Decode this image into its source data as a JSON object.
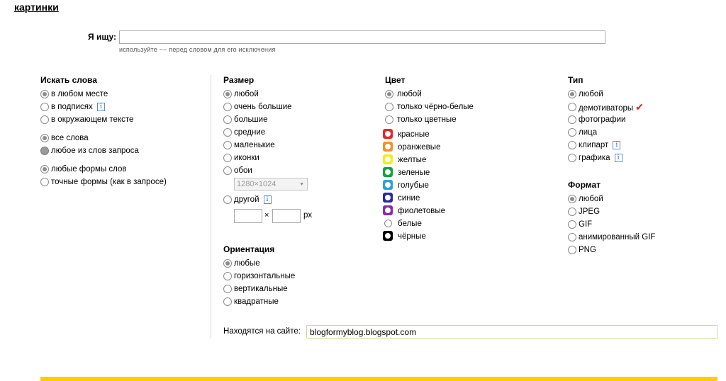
{
  "header": {
    "title": "картинки"
  },
  "search": {
    "label": "Я ищу:",
    "value": "",
    "hint": "используйте ~~ перед словом для его исключения"
  },
  "words": {
    "heading": "Искать слова",
    "groups": [
      [
        "в любом месте",
        "в подписях",
        "в окружающем тексте"
      ],
      [
        "все слова",
        "любое из слов запроса"
      ],
      [
        "любые формы слов",
        "точные формы (как в запросе)"
      ]
    ]
  },
  "size": {
    "heading": "Размер",
    "options": [
      "любой",
      "очень большие",
      "большие",
      "средние",
      "маленькие",
      "иконки",
      "обои"
    ],
    "wallpaper_select": "1280×1024",
    "other_label": "другой",
    "times": "×",
    "unit": "px"
  },
  "orientation": {
    "heading": "Ориентация",
    "options": [
      "любые",
      "горизонтальные",
      "вертикальные",
      "квадратные"
    ]
  },
  "color": {
    "heading": "Цвет",
    "options": [
      "любой",
      "только чёрно-белые",
      "только цветные"
    ],
    "swatches": [
      {
        "label": "красные",
        "color": "#e8262c"
      },
      {
        "label": "оранжевые",
        "color": "#f39221"
      },
      {
        "label": "желтые",
        "color": "#f2ee1b"
      },
      {
        "label": "зеленые",
        "color": "#14a33b"
      },
      {
        "label": "голубые",
        "color": "#2fa0d8"
      },
      {
        "label": "синие",
        "color": "#2a2a9c"
      },
      {
        "label": "фиолетовые",
        "color": "#8b2ab1"
      },
      {
        "label": "белые",
        "color": "#ffffff"
      },
      {
        "label": "чёрные",
        "color": "#000000"
      }
    ]
  },
  "type": {
    "heading": "Тип",
    "options": [
      "любой",
      "демотиваторы",
      "фотографии",
      "лица",
      "клипарт",
      "графика"
    ]
  },
  "format": {
    "heading": "Формат",
    "options": [
      "любой",
      "JPEG",
      "GIF",
      "анимированный GIF",
      "PNG"
    ]
  },
  "site": {
    "label": "Находятся на сайте:",
    "value": "blogformyblog.blogspot.com"
  },
  "info_glyph": "i",
  "tick_glyph": "✔",
  "accent": {
    "bar": "#ffcc00"
  }
}
